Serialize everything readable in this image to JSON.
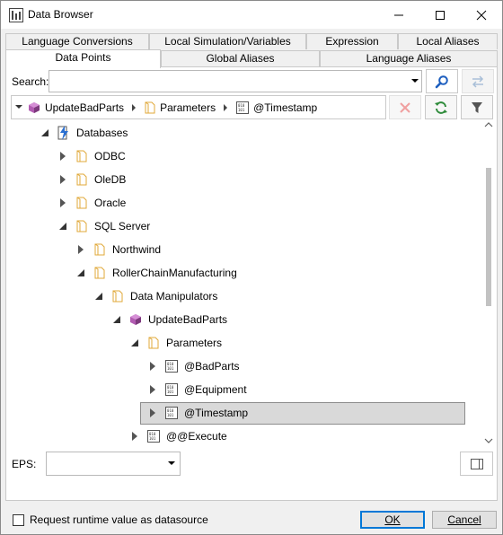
{
  "window": {
    "title": "Data Browser"
  },
  "tabs": [
    {
      "label": "Language Conversions",
      "active": false
    },
    {
      "label": "Local Simulation/Variables",
      "active": false
    },
    {
      "label": "Expression",
      "active": false
    },
    {
      "label": "Local Aliases",
      "active": false
    },
    {
      "label": "Data Points",
      "active": true
    },
    {
      "label": "Global Aliases",
      "active": false
    },
    {
      "label": "Language Aliases",
      "active": false
    }
  ],
  "search": {
    "label": "Search:",
    "value": ""
  },
  "breadcrumb": [
    {
      "label": "UpdateBadParts",
      "icon": "cube-icon"
    },
    {
      "label": "Parameters",
      "icon": "folder-icon"
    },
    {
      "label": "@Timestamp",
      "icon": "parameter-icon"
    }
  ],
  "tree": [
    {
      "label": "Databases",
      "icon": "database-icon",
      "expanded": true
    },
    {
      "label": "ODBC",
      "icon": "folder-icon",
      "expanded": false
    },
    {
      "label": "OleDB",
      "icon": "folder-icon",
      "expanded": false
    },
    {
      "label": "Oracle",
      "icon": "folder-icon",
      "expanded": false
    },
    {
      "label": "SQL Server",
      "icon": "folder-icon",
      "expanded": true
    },
    {
      "label": "Northwind",
      "icon": "folder-icon",
      "expanded": false
    },
    {
      "label": "RollerChainManufacturing",
      "icon": "folder-icon",
      "expanded": true
    },
    {
      "label": "Data Manipulators",
      "icon": "folder-icon",
      "expanded": true
    },
    {
      "label": "UpdateBadParts",
      "icon": "cube-icon",
      "expanded": true
    },
    {
      "label": "Parameters",
      "icon": "folder-icon",
      "expanded": true
    },
    {
      "label": "@BadParts",
      "icon": "parameter-icon",
      "expanded": false
    },
    {
      "label": "@Equipment",
      "icon": "parameter-icon",
      "expanded": false
    },
    {
      "label": "@Timestamp",
      "icon": "parameter-icon",
      "expanded": false,
      "selected": true
    },
    {
      "label": "@@Execute",
      "icon": "parameter-icon",
      "expanded": false
    }
  ],
  "eps": {
    "label": "EPS:",
    "value": ""
  },
  "footer": {
    "checkbox_label": "Request runtime value as datasource",
    "checked": false,
    "ok_label": "OK",
    "cancel_label": "Cancel"
  },
  "colors": {
    "accent": "#0078d7",
    "folder": "#e8b84a",
    "cube": "#a04aa0",
    "refresh": "#2e8b3a"
  }
}
